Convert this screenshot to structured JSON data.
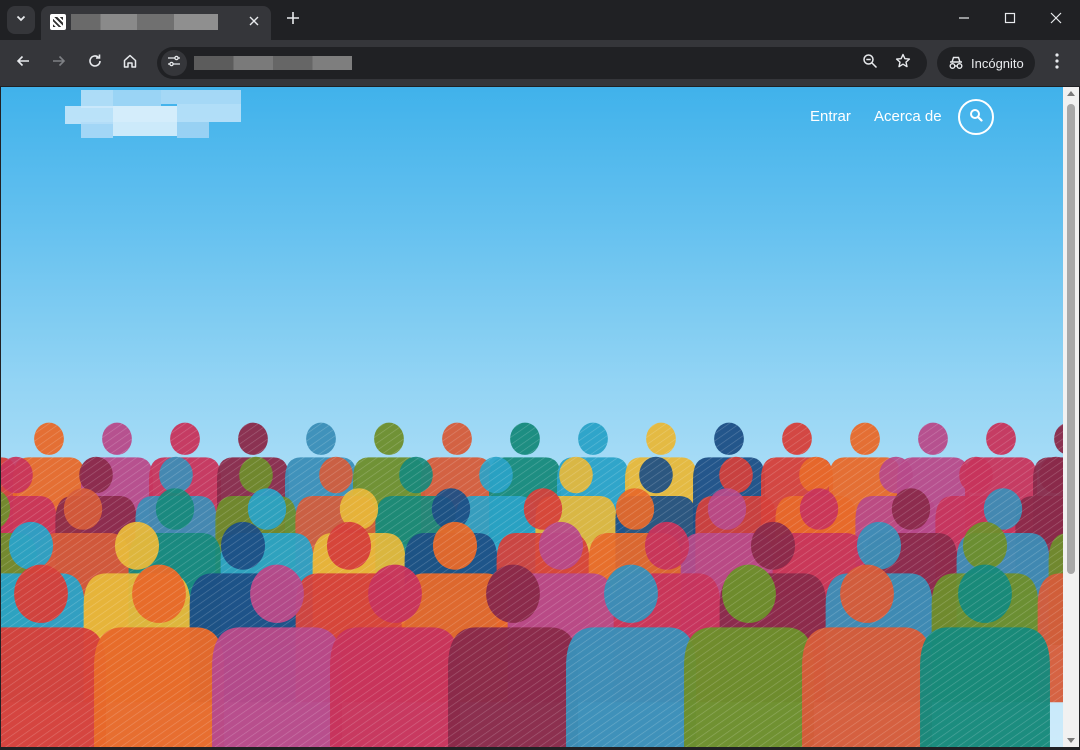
{
  "browser": {
    "tab": {
      "title": "",
      "favicon": "site-favicon"
    },
    "address_bar": {
      "url": ""
    },
    "incognito_label": "Incógnito",
    "icons": {
      "tab_search": "chevron-down-icon",
      "tab_close": "close-icon",
      "new_tab": "plus-icon",
      "minimize": "minimize-icon",
      "maximize": "maximize-icon",
      "close_window": "close-icon",
      "back": "back-arrow-icon",
      "forward": "forward-arrow-icon",
      "reload": "reload-icon",
      "home": "home-icon",
      "site_info": "tune-icon",
      "zoom": "zoom-out-icon",
      "bookmark": "star-icon",
      "incognito": "incognito-icon",
      "menu": "kebab-menu-icon"
    }
  },
  "site": {
    "logo_text": "",
    "nav": {
      "login": "Entrar",
      "about": "Acerca de"
    },
    "search_icon": "search-icon",
    "hero": {
      "image": "crowd-of-colorful-people-illustration"
    }
  },
  "colors": {
    "chrome_frame": "#202124",
    "chrome_toolbar": "#35363a",
    "sky_top": "#40b2eb",
    "sky_bottom": "#cdebfa"
  }
}
